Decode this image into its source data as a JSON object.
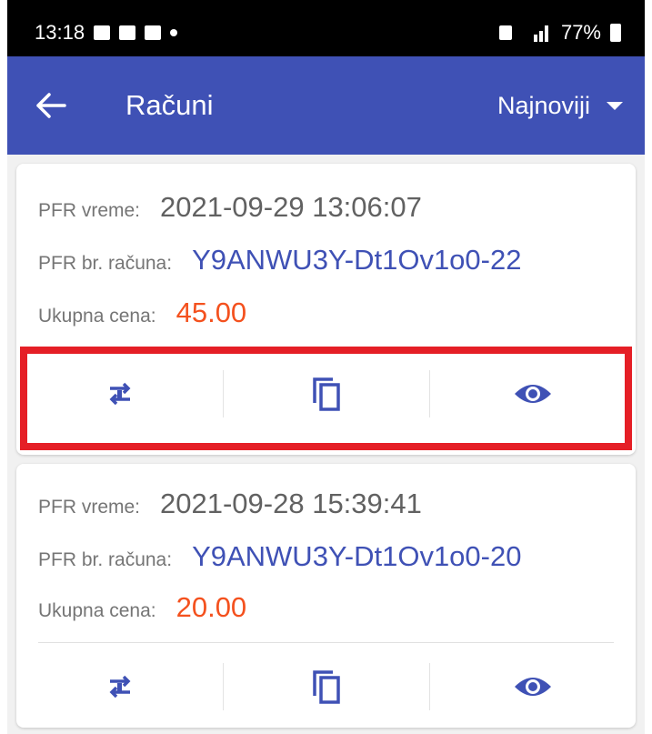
{
  "statusbar": {
    "time": "13:18",
    "battery": "77%"
  },
  "appbar": {
    "title": "Računi",
    "sort_label": "Najnoviji"
  },
  "receipts": [
    {
      "time_label": "PFR vreme:",
      "time_value": "2021-09-29 13:06:07",
      "number_label": "PFR br. računa:",
      "number_value": "Y9ANWU3Y-Dt1Ov1o0-22",
      "total_label": "Ukupna cena:",
      "total_value": "45.00"
    },
    {
      "time_label": "PFR vreme:",
      "time_value": "2021-09-28 15:39:41",
      "number_label": "PFR br. računa:",
      "number_value": "Y9ANWU3Y-Dt1Ov1o0-20",
      "total_label": "Ukupna cena:",
      "total_value": "20.00"
    }
  ],
  "icons": {
    "action_1": "swap-icon",
    "action_2": "copy-icon",
    "action_3": "eye-icon"
  },
  "colors": {
    "primary": "#3f51b5",
    "price": "#f4511e",
    "highlight": "#e51f26"
  }
}
